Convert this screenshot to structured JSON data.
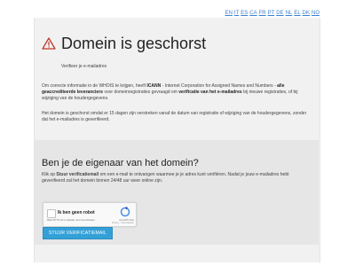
{
  "languages": [
    "EN",
    "IT",
    "ES",
    "CA",
    "FR",
    "PT",
    "DE",
    "NL",
    "EL",
    "DK",
    "NO"
  ],
  "header": {
    "title": "Domein is geschorst",
    "subtitle": "Verifieer je e-mailadres"
  },
  "info": {
    "p1_a": "Om correcte informatie in de WHOIS te krijgen, heeft ",
    "p1_icann": "ICANN",
    "p1_b": " - Internet Corporation for Assigned Names and Numbers - ",
    "p1_c": "alle geaccrediteerde leveranciers",
    "p1_d": " voor domeinregistraties gevraagd om ",
    "p1_e": "verificatie van het e-mailadres",
    "p1_f": " bij nieuwe registraties, of bij wijziging van de houdergegevens.",
    "p2": "Het domein is geschorst omdat er 15 dagen zijn verstreken vanaf de datum van registratie of wijziging van de houdergegevens, zonder dat het e-mailadres is geverifieerd."
  },
  "owner": {
    "title": "Ben je de eigenaar van het domein?",
    "desc_a": "Klik op ",
    "desc_b": "Stuur verificatiemail",
    "desc_c": " om een e-mail te ontvangen waarmee je je adres kunt verifiëren. Nadat je jouw e-mailadres hebt geverifieerd zal het domein binnen 24/48 uur weer online zijn."
  },
  "captcha": {
    "label": "Ik ben geen robot",
    "note": "RECAPTCHA is tijdelijk niet beschikbaar",
    "brand": "reCAPTCHA",
    "terms": "Privacy - Voorwaarden"
  },
  "button": {
    "label": "STUUR VERIFICATIEMAIL"
  },
  "colors": {
    "accent": "#34a0d8",
    "link": "#3a7fd1",
    "warning_icon": "#c0392b"
  }
}
